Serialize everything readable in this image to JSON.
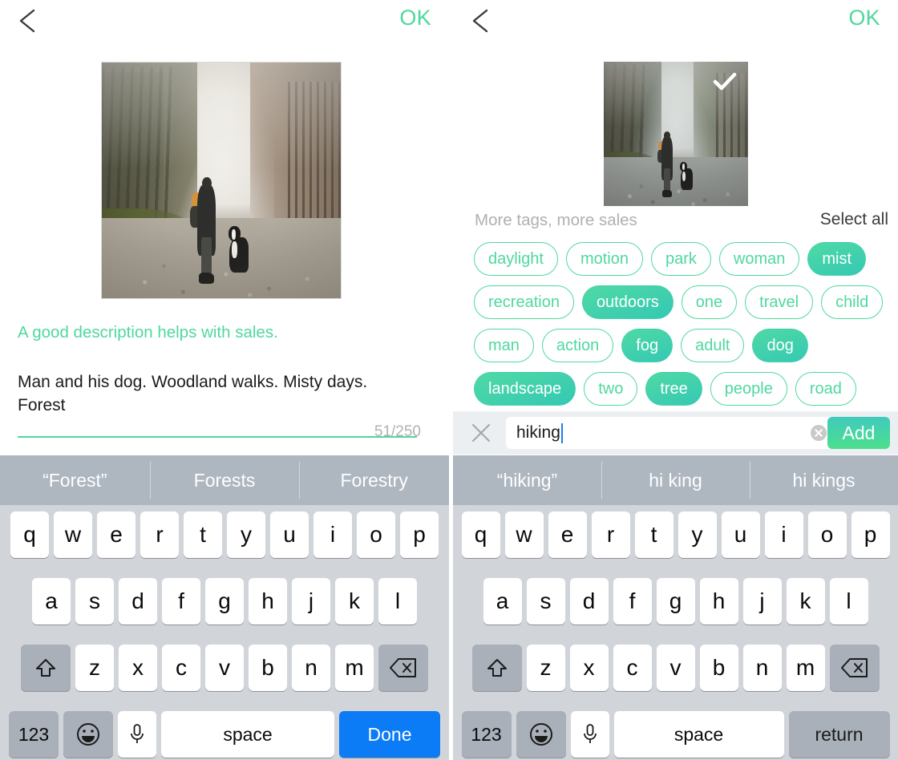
{
  "left_panel": {
    "nav": {
      "back_icon": "chevron-left-icon",
      "ok_label": "OK"
    },
    "photo": {
      "alt": "man-and-dog-forest-road-photo"
    },
    "hint": "A good description helps with sales.",
    "description_value": "Man and his dog. Woodland walks. Misty days. Forest",
    "counter": "51/250",
    "keyboard": {
      "suggestions": [
        "“Forest”",
        "Forests",
        "Forestry"
      ],
      "row1": [
        "q",
        "w",
        "e",
        "r",
        "t",
        "y",
        "u",
        "i",
        "o",
        "p"
      ],
      "row2": [
        "a",
        "s",
        "d",
        "f",
        "g",
        "h",
        "j",
        "k",
        "l"
      ],
      "row3": [
        "z",
        "x",
        "c",
        "v",
        "b",
        "n",
        "m"
      ],
      "shift_icon": "shift-up-arrow-icon",
      "backspace_icon": "backspace-delete-icon",
      "numbers_label": "123",
      "emoji_icon": "smiley-face-icon",
      "mic_icon": "microphone-icon",
      "space_label": "space",
      "action_label": "Done"
    }
  },
  "right_panel": {
    "nav": {
      "back_icon": "chevron-left-icon",
      "ok_label": "OK"
    },
    "photo": {
      "alt": "man-and-dog-forest-road-photo",
      "selected_icon": "checkmark-icon"
    },
    "tags_header": "More tags, more sales",
    "select_all_label": "Select all",
    "tag_rows": [
      [
        {
          "label": "daylight",
          "selected": false
        },
        {
          "label": "motion",
          "selected": false
        },
        {
          "label": "park",
          "selected": false
        },
        {
          "label": "woman",
          "selected": false
        },
        {
          "label": "mist",
          "selected": true
        }
      ],
      [
        {
          "label": "recreation",
          "selected": false
        },
        {
          "label": "outdoors",
          "selected": true
        },
        {
          "label": "one",
          "selected": false
        },
        {
          "label": "travel",
          "selected": false
        },
        {
          "label": "child",
          "selected": false
        }
      ],
      [
        {
          "label": "man",
          "selected": false
        },
        {
          "label": "action",
          "selected": false
        },
        {
          "label": "fog",
          "selected": true
        },
        {
          "label": "adult",
          "selected": false
        },
        {
          "label": "dog",
          "selected": true
        }
      ],
      [
        {
          "label": "landscape",
          "selected": true
        },
        {
          "label": "two",
          "selected": false
        },
        {
          "label": "tree",
          "selected": true
        },
        {
          "label": "people",
          "selected": false
        },
        {
          "label": "road",
          "selected": false
        }
      ]
    ],
    "tag_input": {
      "close_icon": "close-x-icon",
      "value": "hiking",
      "placeholder": "",
      "clear_icon": "clear-circle-icon",
      "add_label": "Add"
    },
    "keyboard": {
      "suggestions": [
        "“hiking”",
        "hi king",
        "hi kings"
      ],
      "row1": [
        "q",
        "w",
        "e",
        "r",
        "t",
        "y",
        "u",
        "i",
        "o",
        "p"
      ],
      "row2": [
        "a",
        "s",
        "d",
        "f",
        "g",
        "h",
        "j",
        "k",
        "l"
      ],
      "row3": [
        "z",
        "x",
        "c",
        "v",
        "b",
        "n",
        "m"
      ],
      "shift_icon": "shift-up-arrow-icon",
      "backspace_icon": "backspace-delete-icon",
      "numbers_label": "123",
      "emoji_icon": "smiley-face-icon",
      "mic_icon": "microphone-icon",
      "space_label": "space",
      "action_label": "return"
    }
  },
  "colors": {
    "accent_green": "#4fd89f",
    "tag_selected_start": "#4fd9a4",
    "tag_selected_end": "#35c9b4",
    "add_button_start": "#3fcabd",
    "add_button_end": "#4ddf8d",
    "done_blue": "#0b7bf6",
    "suggestion_bar": "#aeb6c0",
    "keyboard_bg": "#d1d5da",
    "caret_blue": "#1b7cf2"
  }
}
